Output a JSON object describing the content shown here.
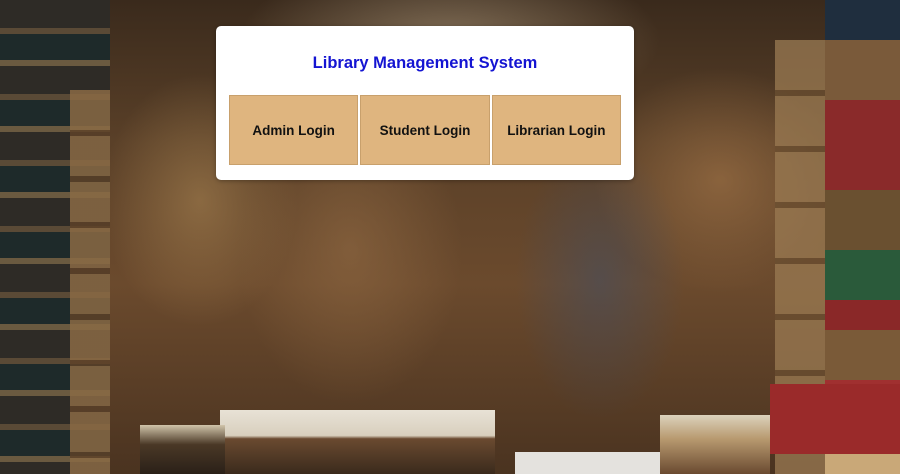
{
  "app": {
    "title": "Library Management System"
  },
  "login_options": [
    {
      "label": "Admin Login"
    },
    {
      "label": "Student Login"
    },
    {
      "label": "Librarian Login"
    }
  ],
  "colors": {
    "title": "#1414d2",
    "button_bg": "#dfb57f",
    "panel_bg": "#ffffff"
  },
  "background": {
    "description_icon": "library-books-background-image"
  }
}
